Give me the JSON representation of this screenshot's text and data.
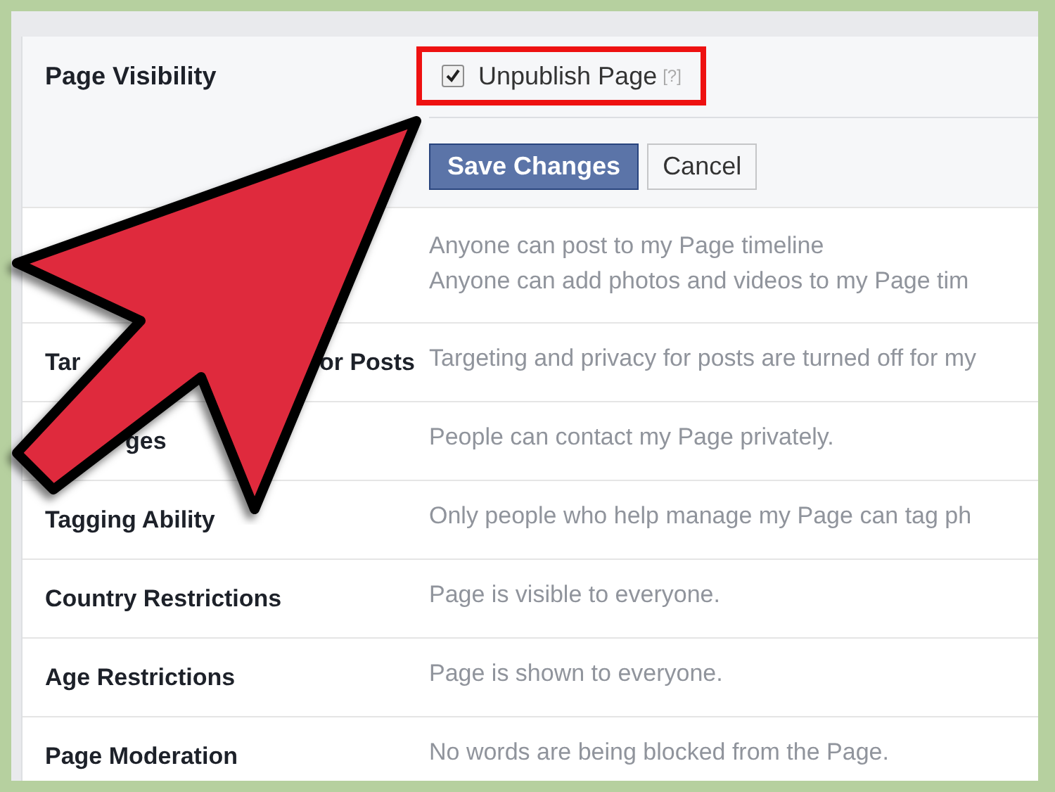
{
  "visibility": {
    "label": "Page Visibility",
    "option": {
      "label": "Unpublish Page",
      "checked": true,
      "help": "[?]",
      "highlighted": true
    },
    "buttons": [
      {
        "label": "Save Changes",
        "kind": "primary"
      },
      {
        "label": "Cancel",
        "kind": "secondary"
      }
    ]
  },
  "rows": [
    {
      "label_parts": [],
      "values": [
        "Anyone can post to my Page timeline",
        "Anyone can add photos and videos to my Page tim"
      ]
    },
    {
      "label_parts": [
        {
          "text": "Tar",
          "kind": "head"
        },
        {
          "text": "or Posts",
          "kind": "end"
        }
      ],
      "values": [
        "Targeting and privacy for posts are turned off for my"
      ]
    },
    {
      "label_parts": [
        {
          "text": "ges",
          "kind": "tail"
        }
      ],
      "values": [
        "People can contact my Page privately."
      ]
    },
    {
      "label_parts": [
        {
          "text": "Tagging Ability",
          "kind": "head"
        }
      ],
      "values": [
        "Only people who help manage my Page can tag ph"
      ]
    },
    {
      "label_parts": [
        {
          "text": "Country Restrictions",
          "kind": "head"
        }
      ],
      "values": [
        "Page is visible to everyone."
      ]
    },
    {
      "label_parts": [
        {
          "text": "Age Restrictions",
          "kind": "head"
        }
      ],
      "values": [
        "Page is shown to everyone."
      ]
    },
    {
      "label_parts": [
        {
          "text": "Page Moderation",
          "kind": "head"
        }
      ],
      "values": [
        "No words are being blocked from the Page."
      ]
    }
  ]
}
